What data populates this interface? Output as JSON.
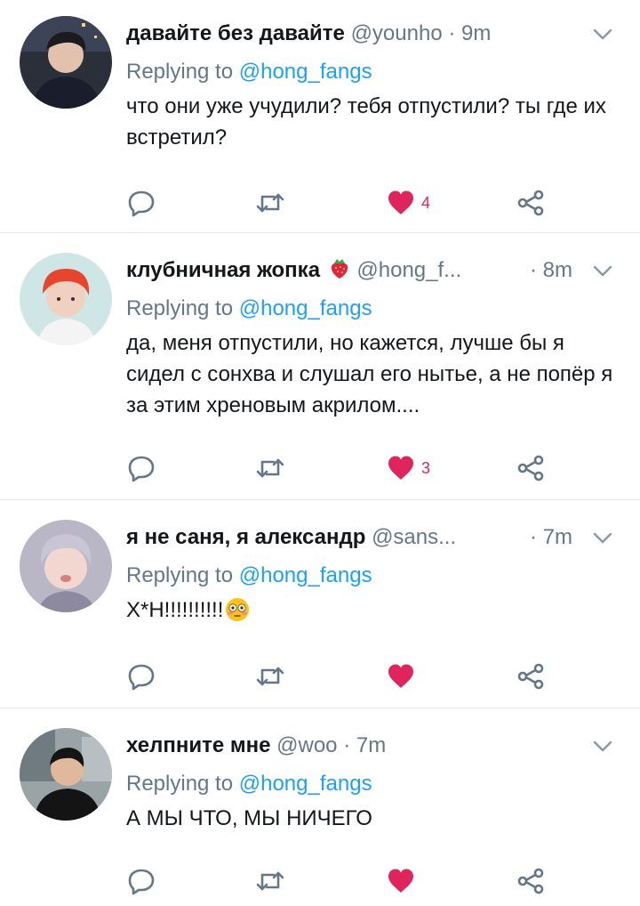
{
  "tweets": [
    {
      "display_name": "давайте без давайте",
      "handle": "@younho",
      "separator": "·",
      "time": "9m",
      "reply_prefix": "Replying to",
      "reply_to": "@hong_fangs",
      "text": "что они уже учудили? тебя отпустили? ты где их встретил?",
      "likes": "4",
      "liked": true,
      "avatar_icon": "user-avatar"
    },
    {
      "display_name": "клубничная жопка",
      "name_emoji": "strawberry-emoji",
      "handle": "@hong_f...",
      "separator": "·",
      "time": "8m",
      "reply_prefix": "Replying to",
      "reply_to": "@hong_fangs",
      "text": "да, меня отпустили, но кажется, лучше бы я сидел с сонхва и слушал его нытье, а не попёр я за этим хреновым акрилом....",
      "likes": "3",
      "liked": true,
      "avatar_icon": "user-avatar"
    },
    {
      "display_name": "я не саня, я александр",
      "handle": "@sans...",
      "separator": "·",
      "time": "7m",
      "reply_prefix": "Replying to",
      "reply_to": "@hong_fangs",
      "text": "Х*Н!!!!!!!!!!",
      "text_emoji": "flushed-face-emoji",
      "likes": "",
      "liked": true,
      "avatar_icon": "user-avatar"
    },
    {
      "display_name": "хелпните мне",
      "handle": "@woo",
      "separator": "·",
      "time": "7m",
      "reply_prefix": "Replying to",
      "reply_to": "@hong_fangs",
      "text": "А МЫ ЧТО, МЫ НИЧЕГО",
      "likes": "",
      "liked": true,
      "avatar_icon": "user-avatar"
    }
  ],
  "colors": {
    "accent": "#1da1f2",
    "like": "#e0245e",
    "muted": "#657786",
    "divider": "#e1e8ed"
  },
  "icons": {
    "reply": "reply-icon",
    "retweet": "retweet-icon",
    "like": "heart-icon",
    "share": "share-icon",
    "menu": "chevron-down-icon"
  }
}
